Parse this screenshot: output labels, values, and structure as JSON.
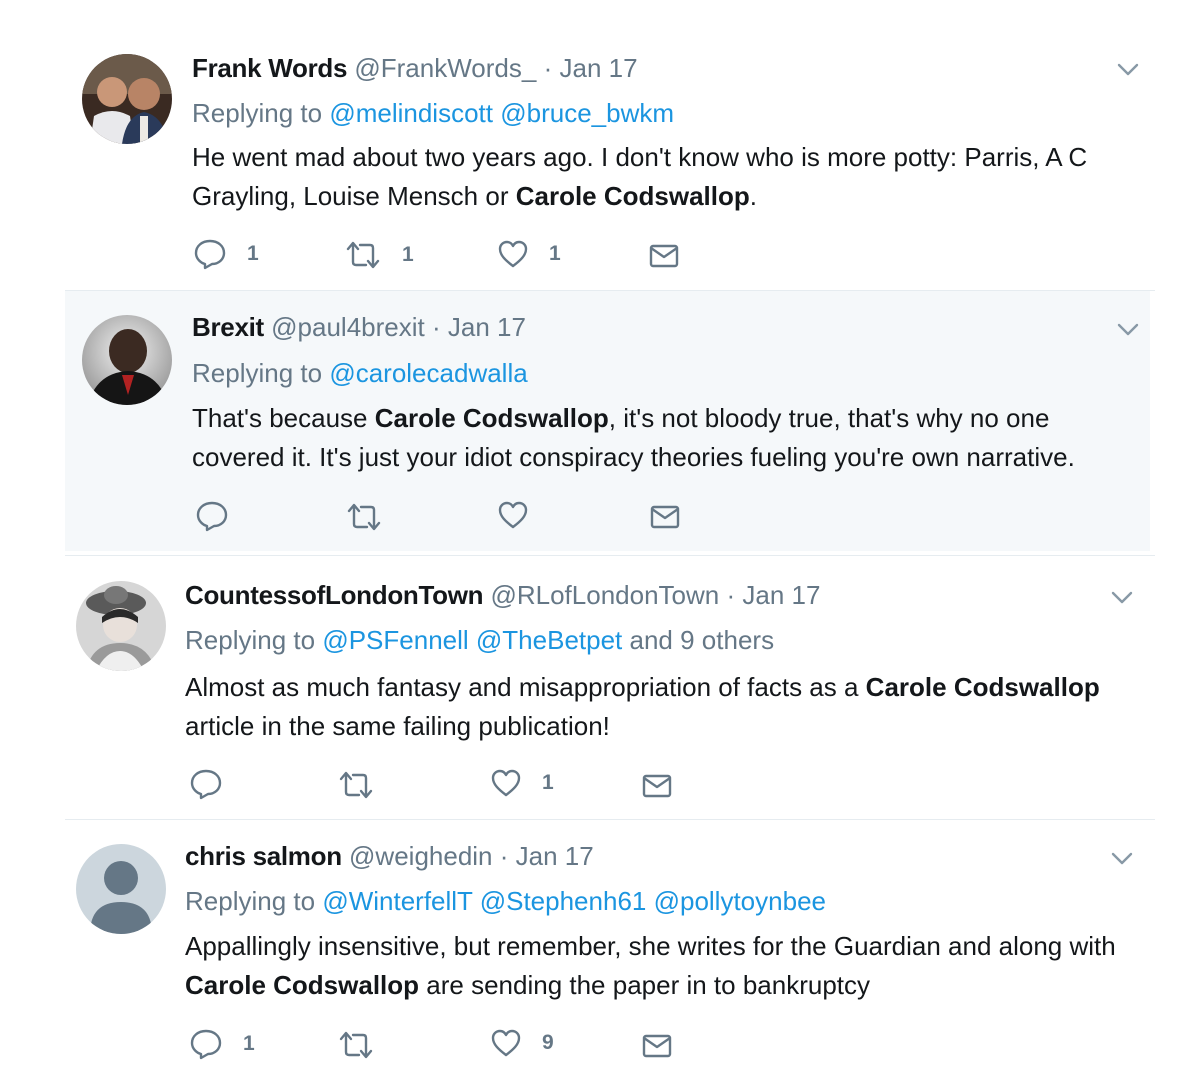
{
  "tweets": [
    {
      "name": "Frank Words",
      "handle": "@FrankWords_",
      "date": "Jan 17",
      "replying_label": "Replying to",
      "mentions": [
        "@melindiscott",
        "@bruce_bwkm"
      ],
      "others": "",
      "text_parts": [
        "He went mad about two years ago. I don't know who is more potty: Parris, A C Grayling, Louise Mensch or ",
        "Carole Codswallop",
        "."
      ],
      "counts": {
        "reply": "1",
        "retweet": "1",
        "like": "1"
      },
      "highlighted": false
    },
    {
      "name": "Brexit",
      "handle": "@paul4brexit",
      "date": "Jan 17",
      "replying_label": "Replying to",
      "mentions": [
        "@carolecadwalla"
      ],
      "others": "",
      "text_parts": [
        "That's because ",
        "Carole Codswallop",
        ", it's not bloody true, that's why no one covered it. It's just your idiot conspiracy theories fueling you're own narrative."
      ],
      "counts": {
        "reply": "",
        "retweet": "",
        "like": ""
      },
      "highlighted": true
    },
    {
      "name": "CountessofLondonTown",
      "handle": "@RLofLondonTown",
      "date": "Jan 17",
      "replying_label": "Replying to",
      "mentions": [
        "@PSFennell",
        "@TheBetpet"
      ],
      "others": "and 9 others",
      "text_parts": [
        "Almost as much fantasy and misappropriation of facts as a ",
        "Carole Codswallop",
        " article in the same failing publication!"
      ],
      "counts": {
        "reply": "",
        "retweet": "",
        "like": "1"
      },
      "highlighted": false
    },
    {
      "name": "chris salmon",
      "handle": "@weighedin",
      "date": "Jan 17",
      "replying_label": "Replying to",
      "mentions": [
        "@WinterfellT",
        "@Stephenh61",
        "@pollytoynbee"
      ],
      "others": "",
      "text_parts": [
        "Appallingly insensitive, but remember, she writes for the Guardian and along with ",
        "Carole Codswallop",
        " are sending the paper in to bankruptcy"
      ],
      "counts": {
        "reply": "1",
        "retweet": "",
        "like": "9"
      },
      "highlighted": false
    }
  ],
  "separator": "·",
  "colors": {
    "link": "#1b95e0",
    "muted": "#657786",
    "text": "#14171a",
    "highlight_bg": "#f5f8fa"
  }
}
